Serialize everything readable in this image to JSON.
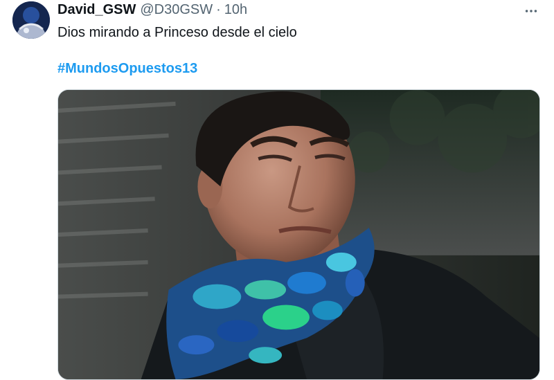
{
  "tweet": {
    "author": {
      "display_name": "David_GSW",
      "handle": "@D30GSW",
      "separator": "·",
      "time": "10h"
    },
    "more_icon": "more-horizontal-icon",
    "text": "Dios mirando a Princeso desde el cielo",
    "hashtag": "#MundosOpuestos13",
    "media": {
      "kind": "image"
    }
  },
  "colors": {
    "text_primary": "#0f1419",
    "text_secondary": "#536471",
    "link": "#1d9bf0",
    "border": "#cfd9de"
  }
}
